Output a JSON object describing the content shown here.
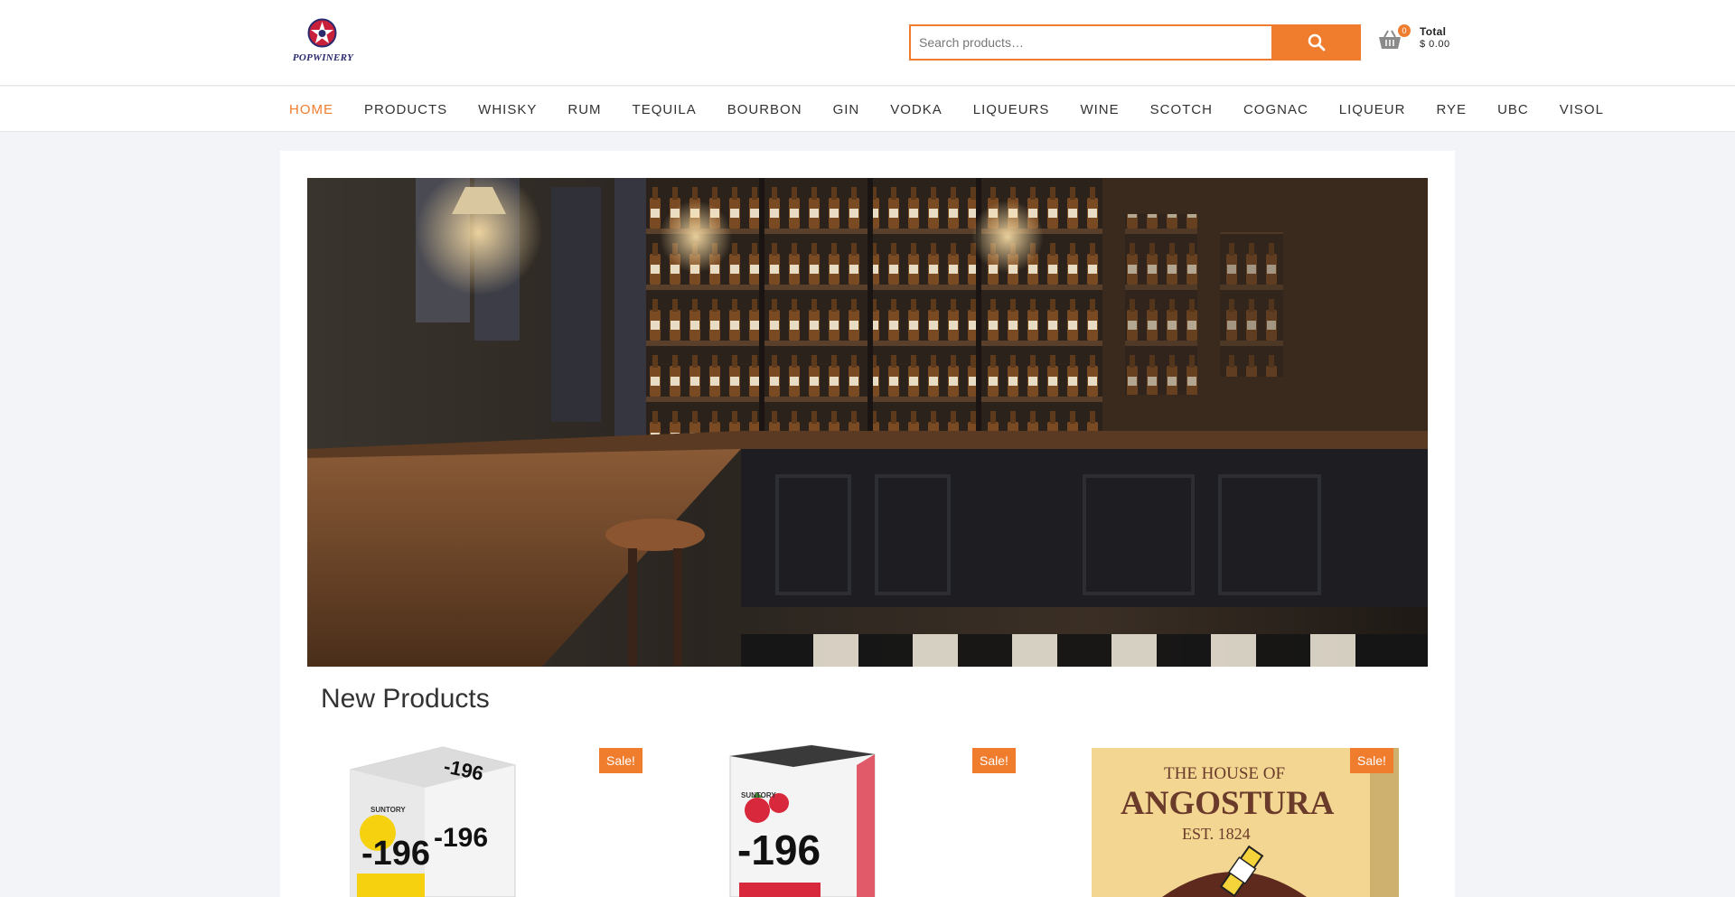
{
  "brand": {
    "logo_text": "POPWINERY"
  },
  "search": {
    "placeholder": "Search products…",
    "button_icon": "search-icon"
  },
  "cart": {
    "count": "0",
    "total_label": "Total",
    "total_value": "$ 0.00"
  },
  "nav": {
    "items": [
      "HOME",
      "PRODUCTS",
      "WHISKY",
      "RUM",
      "TEQUILA",
      "BOURBON",
      "GIN",
      "VODKA",
      "LIQUEURS",
      "WINE",
      "SCOTCH",
      "COGNAC",
      "LIQUEUR",
      "RYE",
      "UBC",
      "VISOL"
    ],
    "active_index": 0
  },
  "main": {
    "section_title": "New Products",
    "products": [
      {
        "sale_label": "Sale!",
        "image": "-196 lemon box",
        "box_brand": "SUNTORY",
        "box_name": "-196"
      },
      {
        "sale_label": "Sale!",
        "image": "-196 strawberry box",
        "box_brand": "SUNTORY",
        "box_name": "-196"
      },
      {
        "sale_label": "Sale!",
        "image": "Angostura poster",
        "poster_line1": "THE HOUSE OF",
        "poster_line2": "ANGOSTURA",
        "poster_line3": "EST. 1824"
      }
    ]
  },
  "colors": {
    "accent": "#f07d2e",
    "background": "#f2f4f7"
  }
}
